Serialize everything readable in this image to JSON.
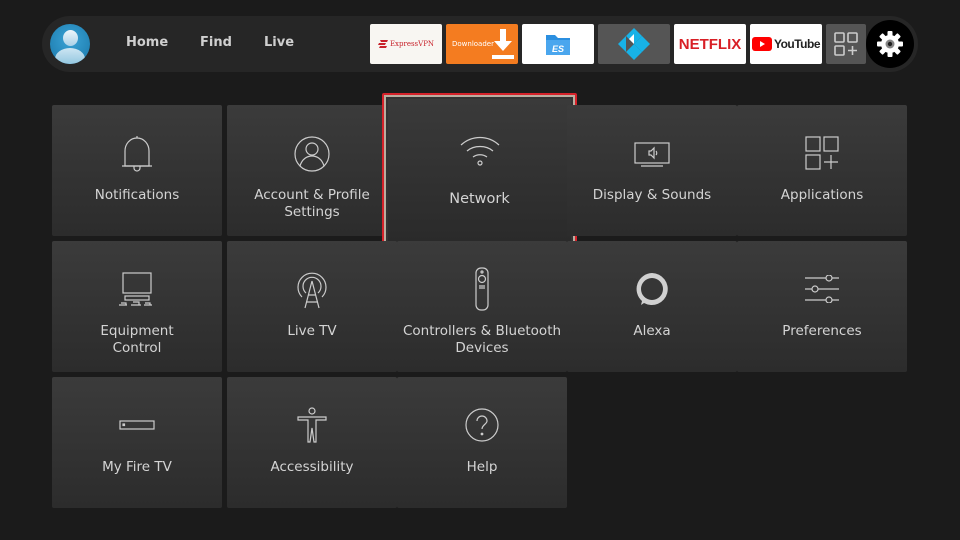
{
  "navbar": {
    "profile_icon": "profile-avatar-icon",
    "links": [
      {
        "label": "Home"
      },
      {
        "label": "Find"
      },
      {
        "label": "Live"
      }
    ],
    "apps": [
      {
        "name": "ExpressVPN",
        "label": "ExpressVPN",
        "color": "#c8232c"
      },
      {
        "name": "Downloader",
        "label": "Downloader",
        "color": "#f47c20"
      },
      {
        "name": "ES File Explorer",
        "label": "ES",
        "color": "#2b8fe0"
      },
      {
        "name": "Kodi",
        "label": "",
        "color": "#17b2e7"
      },
      {
        "name": "Netflix",
        "label": "NETFLIX",
        "color": "#d81f26"
      },
      {
        "name": "YouTube",
        "label": "YouTube",
        "color": "#ff0000"
      },
      {
        "name": "All apps",
        "label": "",
        "icon": "apps-grid-icon"
      }
    ],
    "settings_icon": "gear-icon"
  },
  "settings": {
    "tiles": [
      {
        "label": "Notifications",
        "icon": "bell-icon"
      },
      {
        "label": "Account & Profile Settings",
        "icon": "user-circle-icon"
      },
      {
        "label": "Network",
        "icon": "wifi-icon",
        "focused": true
      },
      {
        "label": "Display & Sounds",
        "icon": "tv-speaker-icon"
      },
      {
        "label": "Applications",
        "icon": "apps-add-icon"
      },
      {
        "label": "Equipment Control",
        "icon": "tv-equipment-icon"
      },
      {
        "label": "Live TV",
        "icon": "antenna-icon"
      },
      {
        "label": "Controllers & Bluetooth Devices",
        "icon": "remote-icon"
      },
      {
        "label": "Alexa",
        "icon": "alexa-ring-icon"
      },
      {
        "label": "Preferences",
        "icon": "sliders-icon"
      },
      {
        "label": "My Fire TV",
        "icon": "fire-tv-device-icon"
      },
      {
        "label": "Accessibility",
        "icon": "accessibility-person-icon"
      },
      {
        "label": "Help",
        "icon": "help-circle-icon"
      }
    ],
    "focus_color": "#d5222a"
  }
}
